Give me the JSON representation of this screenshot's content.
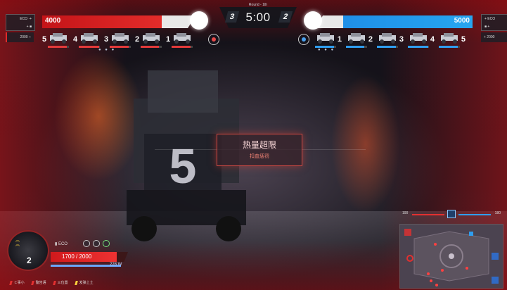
{
  "round_label": "Round - 1th",
  "timer": "5:00",
  "red_team": {
    "base_hp": "4000",
    "base_hp_fraction": 0.78,
    "wins": "3",
    "tag_line1": "ECO ·+",
    "tag_line2": "+ ■",
    "gold": "2000 ⌁",
    "color": "#e32c2a",
    "units": [
      {
        "num": "5",
        "hp": 0.9
      },
      {
        "num": "4",
        "hp": 0.95
      },
      {
        "num": "3",
        "hp": 0.9
      },
      {
        "num": "2",
        "hp": 0.85
      },
      {
        "num": "1",
        "hp": 0.9
      }
    ]
  },
  "blue_team": {
    "base_hp": "5000",
    "base_hp_fraction": 0.82,
    "wins": "2",
    "tag_line1": "+ ECO",
    "tag_line2": "■ +",
    "gold": "+ 2000",
    "color": "#26a6f0",
    "units": [
      {
        "num": "1",
        "hp": 0.9
      },
      {
        "num": "2",
        "hp": 0.85
      },
      {
        "num": "3",
        "hp": 0.9
      },
      {
        "num": "4",
        "hp": 0.95
      },
      {
        "num": "5",
        "hp": 0.9
      }
    ]
  },
  "warning": {
    "title": "热量超限",
    "subtitle": "扣血惩罚"
  },
  "background_robot_number": "5",
  "player": {
    "number": "2",
    "name": "▮ ECO",
    "hp_text": "1700 / 2000",
    "hp_fraction": 0.85,
    "heat_text": "228 W"
  },
  "legend": [
    {
      "label": "ㄷ事小",
      "color": "#e23030"
    },
    {
      "label": "警告语",
      "color": "#e23030"
    },
    {
      "label": "三位置",
      "color": "#e23030"
    },
    {
      "label": "发弹上土",
      "color": "#ffd23c"
    }
  ],
  "minimap": {
    "left_value": "190",
    "right_value": "180"
  }
}
